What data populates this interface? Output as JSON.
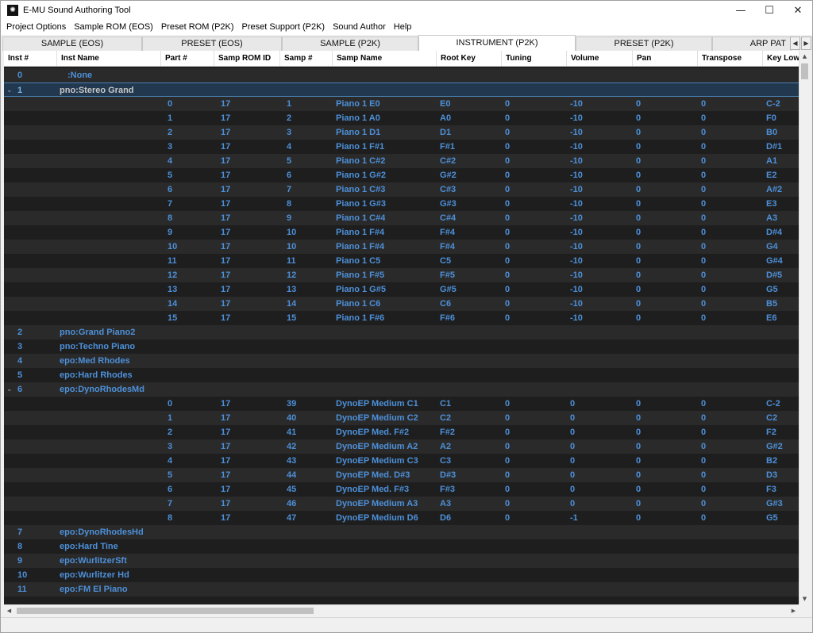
{
  "window": {
    "title": "E-MU Sound Authoring Tool",
    "app_icon": "emu-logo-icon",
    "controls": {
      "minimize": "—",
      "maximize": "☐",
      "close": "✕"
    }
  },
  "menu": [
    "Project Options",
    "Sample ROM (EOS)",
    "Preset ROM (P2K)",
    "Preset Support (P2K)",
    "Sound Author",
    "Help"
  ],
  "tabs": [
    {
      "label": "SAMPLE (EOS)",
      "active": false
    },
    {
      "label": "PRESET (EOS)",
      "active": false
    },
    {
      "label": "SAMPLE (P2K)",
      "active": false
    },
    {
      "label": "INSTRUMENT (P2K)",
      "active": true
    },
    {
      "label": "PRESET (P2K)",
      "active": false
    },
    {
      "label": "ARP PAT",
      "active": false
    }
  ],
  "tab_scroll": {
    "left": "◀",
    "right": "▶"
  },
  "columns": [
    "Inst #",
    "Inst Name",
    "Part #",
    "Samp ROM ID",
    "Samp #",
    "Samp Name",
    "Root Key",
    "Tuning",
    "Volume",
    "Pan",
    "Transpose",
    "Key Low"
  ],
  "rows": [
    {
      "kind": "inst",
      "inst": "0",
      "name": ":None"
    },
    {
      "kind": "inst",
      "inst": "1",
      "name": "pno:Stereo Grand",
      "expanded": true,
      "selected": true
    },
    {
      "kind": "part",
      "part": "0",
      "rom": "17",
      "samp": "1",
      "samp_name": "Piano 1 E0",
      "root": "E0",
      "tuning": "0",
      "volume": "-10",
      "pan": "0",
      "transpose": "0",
      "key_low": "C-2"
    },
    {
      "kind": "part",
      "part": "1",
      "rom": "17",
      "samp": "2",
      "samp_name": "Piano 1 A0",
      "root": "A0",
      "tuning": "0",
      "volume": "-10",
      "pan": "0",
      "transpose": "0",
      "key_low": "F0"
    },
    {
      "kind": "part",
      "part": "2",
      "rom": "17",
      "samp": "3",
      "samp_name": "Piano 1 D1",
      "root": "D1",
      "tuning": "0",
      "volume": "-10",
      "pan": "0",
      "transpose": "0",
      "key_low": "B0"
    },
    {
      "kind": "part",
      "part": "3",
      "rom": "17",
      "samp": "4",
      "samp_name": "Piano 1 F#1",
      "root": "F#1",
      "tuning": "0",
      "volume": "-10",
      "pan": "0",
      "transpose": "0",
      "key_low": "D#1"
    },
    {
      "kind": "part",
      "part": "4",
      "rom": "17",
      "samp": "5",
      "samp_name": "Piano 1 C#2",
      "root": "C#2",
      "tuning": "0",
      "volume": "-10",
      "pan": "0",
      "transpose": "0",
      "key_low": "A1"
    },
    {
      "kind": "part",
      "part": "5",
      "rom": "17",
      "samp": "6",
      "samp_name": "Piano 1 G#2",
      "root": "G#2",
      "tuning": "0",
      "volume": "-10",
      "pan": "0",
      "transpose": "0",
      "key_low": "E2"
    },
    {
      "kind": "part",
      "part": "6",
      "rom": "17",
      "samp": "7",
      "samp_name": "Piano 1 C#3",
      "root": "C#3",
      "tuning": "0",
      "volume": "-10",
      "pan": "0",
      "transpose": "0",
      "key_low": "A#2"
    },
    {
      "kind": "part",
      "part": "7",
      "rom": "17",
      "samp": "8",
      "samp_name": "Piano 1 G#3",
      "root": "G#3",
      "tuning": "0",
      "volume": "-10",
      "pan": "0",
      "transpose": "0",
      "key_low": "E3"
    },
    {
      "kind": "part",
      "part": "8",
      "rom": "17",
      "samp": "9",
      "samp_name": "Piano 1 C#4",
      "root": "C#4",
      "tuning": "0",
      "volume": "-10",
      "pan": "0",
      "transpose": "0",
      "key_low": "A3"
    },
    {
      "kind": "part",
      "part": "9",
      "rom": "17",
      "samp": "10",
      "samp_name": "Piano 1 F#4",
      "root": "F#4",
      "tuning": "0",
      "volume": "-10",
      "pan": "0",
      "transpose": "0",
      "key_low": "D#4"
    },
    {
      "kind": "part",
      "part": "10",
      "rom": "17",
      "samp": "10",
      "samp_name": "Piano 1 F#4",
      "root": "F#4",
      "tuning": "0",
      "volume": "-10",
      "pan": "0",
      "transpose": "0",
      "key_low": "G4"
    },
    {
      "kind": "part",
      "part": "11",
      "rom": "17",
      "samp": "11",
      "samp_name": "Piano 1 C5",
      "root": "C5",
      "tuning": "0",
      "volume": "-10",
      "pan": "0",
      "transpose": "0",
      "key_low": "G#4"
    },
    {
      "kind": "part",
      "part": "12",
      "rom": "17",
      "samp": "12",
      "samp_name": "Piano 1 F#5",
      "root": "F#5",
      "tuning": "0",
      "volume": "-10",
      "pan": "0",
      "transpose": "0",
      "key_low": "D#5"
    },
    {
      "kind": "part",
      "part": "13",
      "rom": "17",
      "samp": "13",
      "samp_name": "Piano 1 G#5",
      "root": "G#5",
      "tuning": "0",
      "volume": "-10",
      "pan": "0",
      "transpose": "0",
      "key_low": "G5"
    },
    {
      "kind": "part",
      "part": "14",
      "rom": "17",
      "samp": "14",
      "samp_name": "Piano 1 C6",
      "root": "C6",
      "tuning": "0",
      "volume": "-10",
      "pan": "0",
      "transpose": "0",
      "key_low": "B5"
    },
    {
      "kind": "part",
      "part": "15",
      "rom": "17",
      "samp": "15",
      "samp_name": "Piano 1 F#6",
      "root": "F#6",
      "tuning": "0",
      "volume": "-10",
      "pan": "0",
      "transpose": "0",
      "key_low": "E6"
    },
    {
      "kind": "inst",
      "inst": "2",
      "name": "pno:Grand Piano2"
    },
    {
      "kind": "inst",
      "inst": "3",
      "name": "pno:Techno Piano"
    },
    {
      "kind": "inst",
      "inst": "4",
      "name": "epo:Med Rhodes"
    },
    {
      "kind": "inst",
      "inst": "5",
      "name": "epo:Hard Rhodes"
    },
    {
      "kind": "inst",
      "inst": "6",
      "name": "epo:DynoRhodesMd",
      "expanded": true
    },
    {
      "kind": "part",
      "part": "0",
      "rom": "17",
      "samp": "39",
      "samp_name": "DynoEP Medium C1",
      "root": "C1",
      "tuning": "0",
      "volume": "0",
      "pan": "0",
      "transpose": "0",
      "key_low": "C-2"
    },
    {
      "kind": "part",
      "part": "1",
      "rom": "17",
      "samp": "40",
      "samp_name": "DynoEP Medium C2",
      "root": "C2",
      "tuning": "0",
      "volume": "0",
      "pan": "0",
      "transpose": "0",
      "key_low": "C2"
    },
    {
      "kind": "part",
      "part": "2",
      "rom": "17",
      "samp": "41",
      "samp_name": "DynoEP Med. F#2",
      "root": "F#2",
      "tuning": "0",
      "volume": "0",
      "pan": "0",
      "transpose": "0",
      "key_low": "F2"
    },
    {
      "kind": "part",
      "part": "3",
      "rom": "17",
      "samp": "42",
      "samp_name": "DynoEP Medium A2",
      "root": "A2",
      "tuning": "0",
      "volume": "0",
      "pan": "0",
      "transpose": "0",
      "key_low": "G#2"
    },
    {
      "kind": "part",
      "part": "4",
      "rom": "17",
      "samp": "43",
      "samp_name": "DynoEP Medium C3",
      "root": "C3",
      "tuning": "0",
      "volume": "0",
      "pan": "0",
      "transpose": "0",
      "key_low": "B2"
    },
    {
      "kind": "part",
      "part": "5",
      "rom": "17",
      "samp": "44",
      "samp_name": "DynoEP Med. D#3",
      "root": "D#3",
      "tuning": "0",
      "volume": "0",
      "pan": "0",
      "transpose": "0",
      "key_low": "D3"
    },
    {
      "kind": "part",
      "part": "6",
      "rom": "17",
      "samp": "45",
      "samp_name": "DynoEP Med. F#3",
      "root": "F#3",
      "tuning": "0",
      "volume": "0",
      "pan": "0",
      "transpose": "0",
      "key_low": "F3"
    },
    {
      "kind": "part",
      "part": "7",
      "rom": "17",
      "samp": "46",
      "samp_name": "DynoEP Medium A3",
      "root": "A3",
      "tuning": "0",
      "volume": "0",
      "pan": "0",
      "transpose": "0",
      "key_low": "G#3"
    },
    {
      "kind": "part",
      "part": "8",
      "rom": "17",
      "samp": "47",
      "samp_name": "DynoEP Medium D6",
      "root": "D6",
      "tuning": "0",
      "volume": "-1",
      "pan": "0",
      "transpose": "0",
      "key_low": "G5"
    },
    {
      "kind": "inst",
      "inst": "7",
      "name": "epo:DynoRhodesHd"
    },
    {
      "kind": "inst",
      "inst": "8",
      "name": "epo:Hard Tine"
    },
    {
      "kind": "inst",
      "inst": "9",
      "name": "epo:WurlitzerSft"
    },
    {
      "kind": "inst",
      "inst": "10",
      "name": "epo:Wurlitzer Hd"
    },
    {
      "kind": "inst",
      "inst": "11",
      "name": "epo:FM El Piano"
    }
  ],
  "expander": {
    "open": "⌄",
    "closed": "›"
  },
  "scroll": {
    "up": "▲",
    "down": "▼",
    "left": "◀",
    "right": "▶"
  }
}
